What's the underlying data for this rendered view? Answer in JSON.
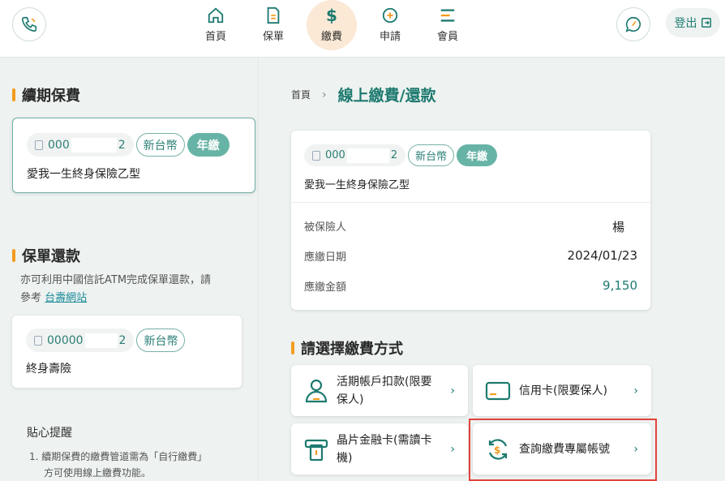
{
  "header": {
    "nav": [
      {
        "label": "首頁",
        "icon": "home-icon"
      },
      {
        "label": "保單",
        "icon": "document-icon"
      },
      {
        "label": "繳費",
        "icon": "dollar-icon",
        "active": true
      },
      {
        "label": "申請",
        "icon": "plus-circle-icon"
      },
      {
        "label": "會員",
        "icon": "menu-icon"
      }
    ],
    "logout_label": "登出"
  },
  "left": {
    "renewal_title": "續期保費",
    "renewal_card": {
      "policy_prefix": "000",
      "policy_suffix": "2",
      "currency_tag": "新台幣",
      "frequency_tag": "年繳",
      "product_name": "愛我一生終身保險乙型"
    },
    "loan_title": "保單還款",
    "loan_note": "亦可利用中國信託ATM完成保單還款，請",
    "loan_note2_prefix": "參考",
    "loan_link": "台壽網站",
    "loan_card": {
      "policy_prefix": "00000",
      "policy_suffix": "2",
      "currency_tag": "新台幣",
      "product_name": "終身壽險"
    },
    "tips_title": "貼心提醒",
    "tips_line1": "1.  續期保費的繳費管道需為「自行繳費」",
    "tips_line2": "方可使用線上繳費功能。"
  },
  "right": {
    "breadcrumb_home": "首頁",
    "breadcrumb_sep": "›",
    "breadcrumb_current": "線上繳費/還款",
    "policy_card": {
      "policy_prefix": "000",
      "policy_suffix": "2",
      "currency_tag": "新台幣",
      "frequency_tag": "年繳",
      "product_name": "愛我一生終身保險乙型",
      "insured_label": "被保險人",
      "insured_value": "楊",
      "due_date_label": "應繳日期",
      "due_date_value": "2024/01/23",
      "amount_label": "應繳金額",
      "amount_value": "9,150"
    },
    "method_title": "請選擇繳費方式",
    "methods": [
      {
        "label": "活期帳戶扣款(限要保人)",
        "icon": "account-user-icon"
      },
      {
        "label": "信用卡(限要保人)",
        "icon": "credit-card-icon"
      },
      {
        "label": "晶片金融卡(需讀卡機)",
        "icon": "card-reader-icon"
      },
      {
        "label": "查詢繳費專屬帳號",
        "icon": "refresh-dollar-icon"
      }
    ]
  },
  "colors": {
    "accent": "#1d7a6f",
    "orange": "#f29c1f",
    "highlight": "#e0433b"
  }
}
